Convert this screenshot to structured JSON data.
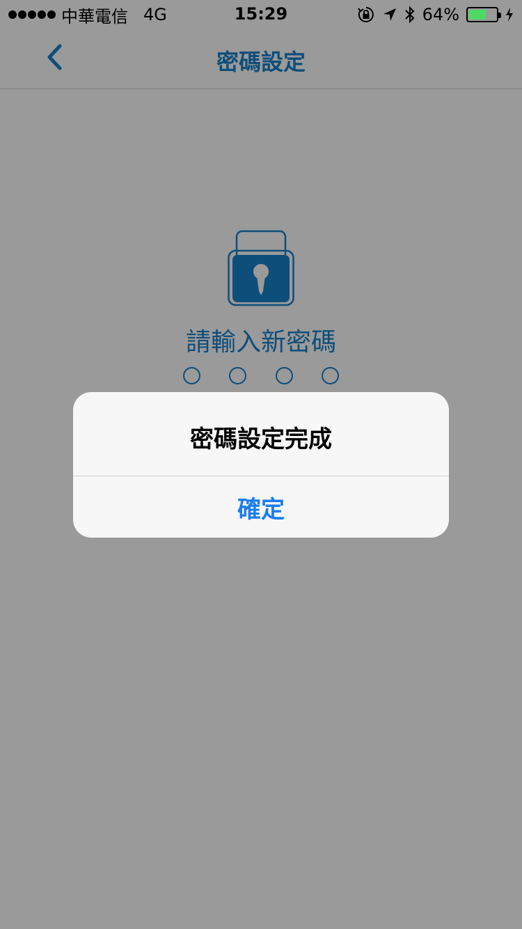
{
  "status_bar": {
    "signal_dots": 5,
    "carrier": "中華電信",
    "network": "4G",
    "time": "15:29",
    "icons": [
      "rotation-lock-icon",
      "location-arrow-icon",
      "bluetooth-icon"
    ],
    "battery_percent": "64%",
    "battery_level": 0.64,
    "battery_color": "#4cd964"
  },
  "nav": {
    "back_icon": "chevron-left-icon",
    "title": "密碼設定"
  },
  "lock_screen": {
    "lock_icon": "padlock-icon",
    "prompt": "請輸入新密碼",
    "pin_length": 4,
    "pin_filled": 0
  },
  "alert": {
    "title": "密碼設定完成",
    "confirm_label": "確定"
  },
  "colors": {
    "accent": "#0e4e7a",
    "alert_button": "#1a7cf0",
    "overlay_background": "#9a9a9a"
  }
}
